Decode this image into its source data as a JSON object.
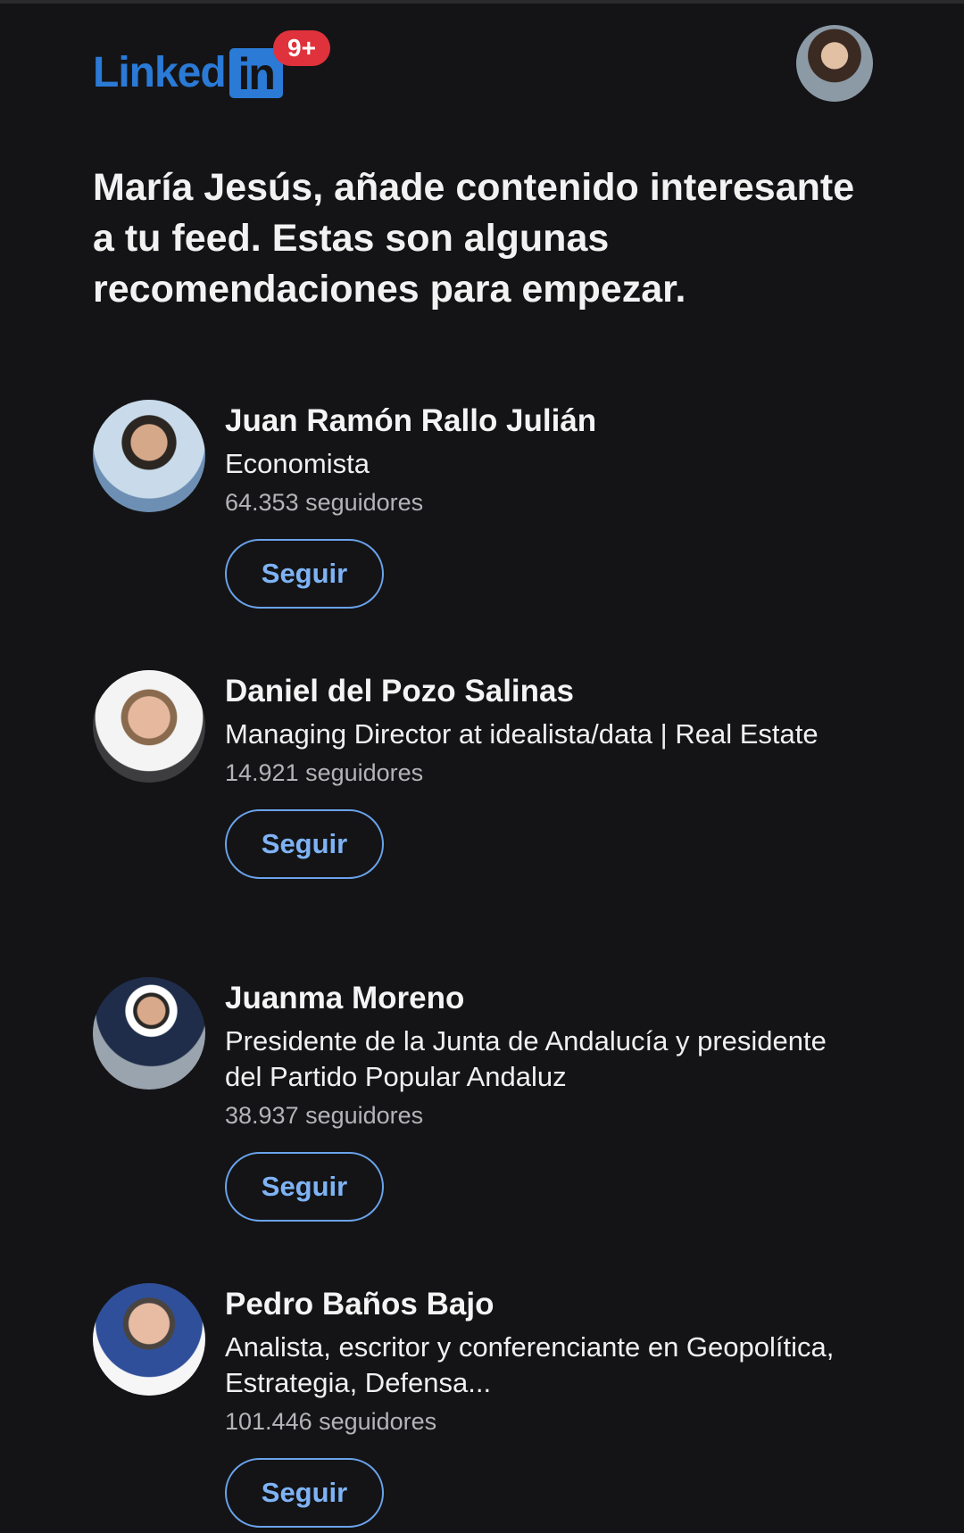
{
  "header": {
    "logo_text": "Linked",
    "logo_in": "in",
    "notification_count": "9+",
    "profile_avatar_icon": "user-avatar"
  },
  "heading": "María Jesús, añade contenido interesante a tu feed. Estas son algunas recomendaciones para empezar.",
  "recommendations": [
    {
      "name": "Juan Ramón Rallo Julián",
      "headline": "Economista",
      "followers": "64.353 seguidores",
      "button": "Seguir"
    },
    {
      "name": "Daniel del Pozo Salinas",
      "headline": "Managing Director at idealista/data | Real Estate",
      "followers": "14.921 seguidores",
      "button": "Seguir"
    },
    {
      "name": "Juanma Moreno",
      "headline": "Presidente de la Junta de Andalucía y presidente del Partido Popular Andaluz",
      "followers": "38.937 seguidores",
      "button": "Seguir"
    },
    {
      "name": "Pedro Baños Bajo",
      "headline": "Analista, escritor y conferenciante en Geopolítica, Estrategia, Defensa...",
      "followers": "101.446 seguidores",
      "button": "Seguir"
    }
  ],
  "colors": {
    "background": "#141416",
    "brand": "#2a7ad6",
    "badge": "#e0323c",
    "button_text": "#7eb3f5"
  }
}
